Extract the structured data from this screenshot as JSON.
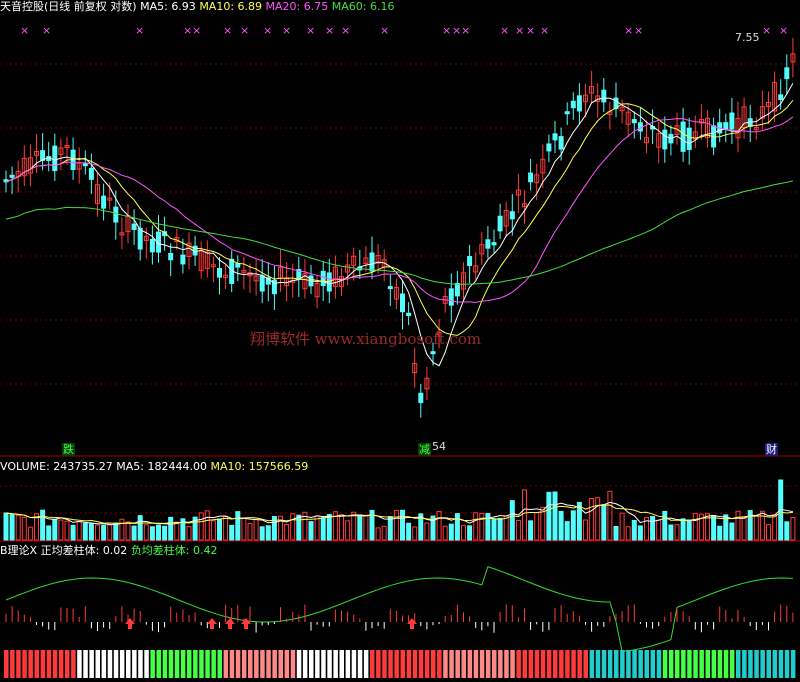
{
  "colors": {
    "bg": "#000000",
    "up": "#ff3a3a",
    "down": "#54fcfc",
    "ma5": "#ffffff",
    "ma10": "#ffff55",
    "ma20": "#ff55ff",
    "ma60": "#44dd44",
    "grid": "#7a0000",
    "signal": "#ffffff",
    "watermark": "#9a2a2a"
  },
  "price_panel": {
    "title": "天音控股(日线 前复权 对数)",
    "ma5_label": "MA5:",
    "ma5_value": "6.93",
    "ma10_label": "MA10:",
    "ma10_value": "6.89",
    "ma20_label": "MA20:",
    "ma20_value": "6.75",
    "ma60_label": "MA60:",
    "ma60_value": "6.16",
    "high_mark": "7.55",
    "low_mark": "54",
    "markers": [
      {
        "text": "跌",
        "color": "#44ff44",
        "bg": "#064006"
      },
      {
        "text": "减",
        "color": "#44ff44",
        "bg": "#064006"
      },
      {
        "text": "财",
        "color": "#ffffff",
        "bg": "#1a1a7a"
      }
    ],
    "watermark": "翔博软件 www.xiangbosoft.com",
    "x_symbol": "×"
  },
  "volume_panel": {
    "label": "VOLUME:",
    "value": "243735.27",
    "ma5_label": "MA5:",
    "ma5_value": "182444.00",
    "ma10_label": "MA10:",
    "ma10_value": "157566.59"
  },
  "indicator_panel": {
    "name": "B理论X",
    "pos_label": "正均差柱体:",
    "pos_value": "0.02",
    "neg_label": "负均差柱体:",
    "neg_value": "0.42"
  }
}
